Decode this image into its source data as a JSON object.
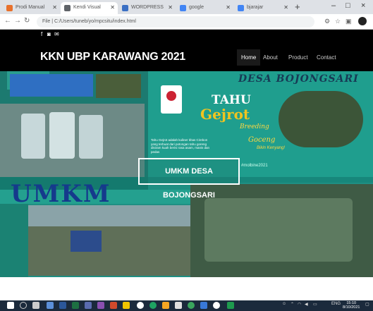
{
  "browser": {
    "tabs": [
      {
        "label": "Prodi Manual",
        "favicon_color": "#e8712c",
        "active": false
      },
      {
        "label": "Kendi Visual",
        "favicon_color": "#5f6368",
        "active": true
      },
      {
        "label": "WORDPRESS",
        "favicon_color": "#3b70c4",
        "active": false
      },
      {
        "label": "google",
        "favicon_color": "#4285f4",
        "active": false
      },
      {
        "label": "bjarajar",
        "favicon_color": "#4285f4",
        "active": false
      }
    ],
    "url": "File | C:/Users/tuneb/yo/mpcsitu/index.html",
    "new_tab_symbol": "+",
    "window_controls": [
      "–",
      "□",
      "×"
    ]
  },
  "site": {
    "social_icons": [
      "facebook-icon",
      "instagram-icon",
      "mail-icon"
    ],
    "brand": "KKN UBP KARAWANG 2021",
    "nav": [
      "Home",
      "About",
      "Product",
      "Contact"
    ],
    "hero": {
      "caption": "UMKM DESA BOJONGSARI",
      "umkm_text": "UMKM",
      "poster": {
        "desa": "DESA BOJONGSARI",
        "tahu": "TAHU",
        "gejrot": "Gejrot",
        "breeding": "Breeding",
        "goceng": "Goceng",
        "bikin": "Bikin Kenyang!",
        "description": "Tahu Gejrot adalah kuliner khas Cirebon yang terbuat dari potongan tahu goreng disiram kuah berisi rasa asam, manis dan pedas",
        "hashtag": "#molbine2021"
      }
    }
  },
  "taskbar": {
    "clock_time": "15:10",
    "clock_date": "8/10/2021",
    "lang": "ENG"
  }
}
